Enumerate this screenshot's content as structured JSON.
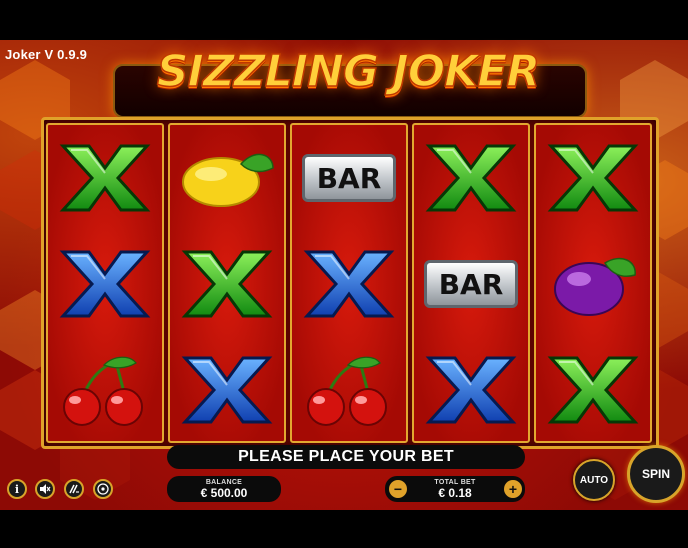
{
  "game": {
    "version_label": "Joker V 0.9.9",
    "logo_text": "SIZZLING JOKER"
  },
  "reels": [
    [
      "green-x",
      "blue-x",
      "cherries"
    ],
    [
      "lemon",
      "green-x",
      "blue-x"
    ],
    [
      "bar",
      "blue-x",
      "cherries"
    ],
    [
      "green-x",
      "bar",
      "blue-x"
    ],
    [
      "green-x",
      "plum",
      "green-x"
    ]
  ],
  "symbol_labels": {
    "bar": "BAR"
  },
  "status": {
    "message": "PLEASE PLACE YOUR BET"
  },
  "balance": {
    "label": "BALANCE",
    "value": "€ 500.00"
  },
  "total_bet": {
    "label": "TOTAL BET",
    "value": "€ 0.18",
    "minus": "−",
    "plus": "+"
  },
  "buttons": {
    "auto": "AUTO",
    "spin": "SPIN"
  },
  "colors": {
    "accent_gold": "#e0a22a",
    "reel_red": "#c8120a",
    "x_green": "#2fb82f",
    "x_blue": "#1f5fd6"
  }
}
